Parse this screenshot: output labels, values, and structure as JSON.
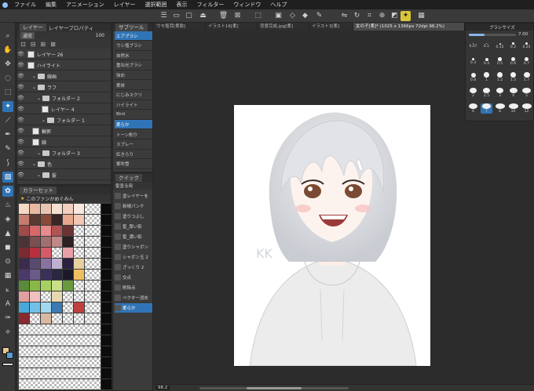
{
  "menu": [
    "ファイル",
    "編集",
    "アニメーション",
    "レイヤー",
    "選択範囲",
    "表示",
    "フィルター",
    "ウィンドウ",
    "ヘルプ"
  ],
  "layer_panel": {
    "tabs": [
      "レイヤー",
      "レイヤープロパティ"
    ],
    "blend_mode": "通常",
    "opacity": "100",
    "layers": [
      {
        "name": "レイヤー 26",
        "kind": "layer",
        "indent": 0
      },
      {
        "name": "ハイライト",
        "kind": "layer",
        "indent": 0
      },
      {
        "name": "線画",
        "kind": "folder",
        "indent": 1
      },
      {
        "name": "ラフ",
        "kind": "folder",
        "indent": 1
      },
      {
        "name": "フォルダー 2",
        "kind": "folder",
        "indent": 2
      },
      {
        "name": "レイヤー 4",
        "kind": "layer",
        "indent": 3
      },
      {
        "name": "フォルダー 1",
        "kind": "folder",
        "indent": 3
      },
      {
        "name": "輪郭",
        "kind": "layer",
        "indent": 1
      },
      {
        "name": "線",
        "kind": "layer",
        "indent": 1
      },
      {
        "name": "フォルダー 3",
        "kind": "folder",
        "indent": 2
      },
      {
        "name": "色",
        "kind": "folder",
        "indent": 1
      },
      {
        "name": "髪",
        "kind": "folder",
        "indent": 2
      }
    ]
  },
  "color_set": {
    "tabs": [
      "カラーセット"
    ],
    "set_name": "このファンかめぐみん",
    "swatches": [
      [
        "#f4d9c6",
        "#e8b9a0",
        "#e8c5b0",
        "#f5dfd0",
        "#f2cfc0",
        "#f7e8e0"
      ],
      [
        "#c47d6d",
        "#5a3a32",
        "#8a4a3a",
        "#3a2624",
        "#e7a88e",
        "#f0c8b4"
      ],
      [
        "#a04a4a",
        "#d6686a",
        "#e98a8c",
        "#b25252",
        "#6a3434",
        "#ffffff"
      ],
      [
        "#4a3436",
        "#7a5050",
        "#a07070",
        "#c08888",
        "#2c2022",
        "#ffffff"
      ],
      [
        "#7a2a30",
        "#b83040",
        "#d65a68",
        "#ffffff",
        "#e8a0a8",
        "#ffffff"
      ],
      [
        "#3a2c4a",
        "#5a4a72",
        "#8a72a0",
        "#c0b0d0",
        "#2a2040",
        "#e8d0a0"
      ],
      [
        "#4a3a6a",
        "#6a5a8a",
        "#3a3058",
        "#2a2840",
        "#1c1a28",
        "#f0c060"
      ],
      [
        "#5a8a3a",
        "#8ab848",
        "#a8d060",
        "#c8e088",
        "#6a9a40",
        "#ffffff"
      ],
      [
        "#e0a0a0",
        "#f0c0c0",
        "#ffffff",
        "#e8d8b0",
        "#ffffff",
        "#ffffff"
      ],
      [
        "#4aa8d8",
        "#70c0e8",
        "#a0d8f0",
        "#3a7ab0",
        "#ffffff",
        "#c04040"
      ],
      [
        "#8a2a30",
        "#ffffff",
        "#d8b8a0",
        "#ffffff",
        "#ffffff",
        "#ffffff"
      ]
    ]
  },
  "sub_tool": {
    "tab": "サブツール",
    "brushes": [
      "エアブラシ",
      "ウシ塩ブラシ",
      "自然水",
      "重ね光ブラシ",
      "強め",
      "柔体",
      "にじみスクリ",
      "ハイライト",
      "Bird",
      "柔らか",
      "トーン削り",
      "スプレー",
      "紅きらり",
      "紫吹雪"
    ]
  },
  "quick_access": {
    "tab": "クイック",
    "set": "髪塗る用",
    "items": [
      "塗レイヤーを",
      "新規パンケ",
      "塗りつぶし",
      "髪_厚い影",
      "髪_濃い影",
      "塗りシャボン",
      "シャボン玉 2",
      "ざっくり 2",
      "交点",
      "削除点",
      "ベクター消去",
      "柔らか"
    ]
  },
  "doc_tabs": [
    "ウモ塩芽[柔軟]",
    "イラスト16[柔]",
    "背景完成.jpg[柔]",
    "イラスト3[柔]",
    "女の子[柔]* (1025 x 1366px 72dpi 98.2%)"
  ],
  "brush_size": {
    "title": "ブラシサイズ",
    "value": "7.00",
    "sizes": [
      "0.07",
      "0.1",
      "0.15",
      "0.2",
      "0.25",
      "0.3",
      "0.4",
      "0.5",
      "0.6",
      "0.7",
      "0.8",
      "1",
      "1.2",
      "1.5",
      "1.7",
      "2",
      "2.5",
      "3",
      "4",
      "5",
      "6",
      "7",
      "8",
      "10",
      "12"
    ]
  },
  "status": {
    "zoom": "98.2"
  }
}
